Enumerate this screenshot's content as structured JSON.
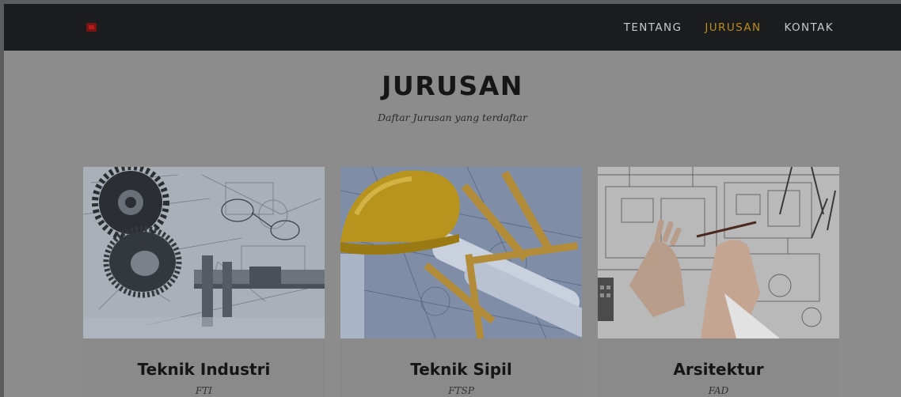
{
  "navbar": {
    "logo": "brand-logo",
    "links": [
      {
        "label": "TENTANG",
        "active": false
      },
      {
        "label": "JURUSAN",
        "active": true
      },
      {
        "label": "KONTAK",
        "active": false
      }
    ],
    "active_color": "#b98d1c"
  },
  "section": {
    "title": "JURUSAN",
    "subtitle": "Daftar Jurusan yang terdaftar"
  },
  "cards": [
    {
      "name": "Teknik Industri",
      "code": "FTI",
      "image": "gears-and-caliper-photo"
    },
    {
      "name": "Teknik Sipil",
      "code": "FTSP",
      "image": "hard-hat-and-blueprints-photo"
    },
    {
      "name": "Arsitektur",
      "code": "FAD",
      "image": "architect-drawing-floorplan-photo"
    }
  ]
}
